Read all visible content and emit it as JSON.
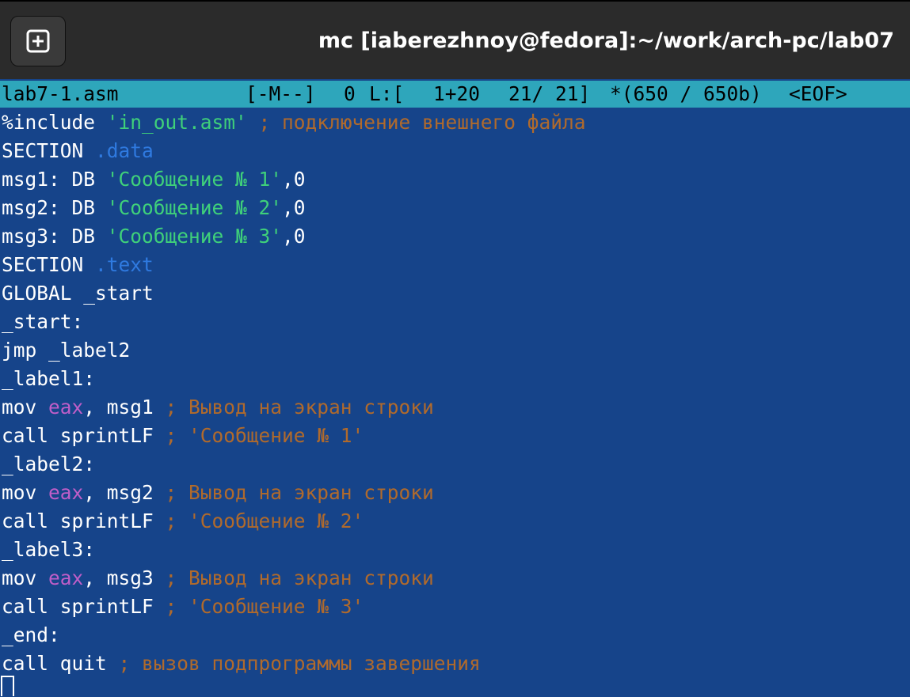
{
  "window": {
    "title": "mc [iaberezhnoy@fedora]:~/work/arch-pc/lab07",
    "new_tab_icon": "plus-in-square-icon"
  },
  "status": {
    "filename": "lab7-1.asm",
    "flags": "[-M--]",
    "col": "0",
    "line_label": "L:[",
    "line_pos": "1+20",
    "line_total": "21/ 21]",
    "bytes": "*(650 / 650b)",
    "eof": "<EOF>"
  },
  "colors": {
    "editor_bg": "#16448a",
    "status_bg": "#2ea6bb",
    "string": "#3fd07a",
    "section": "#2f7ae0",
    "comment": "#b06a2c",
    "register": "#c05ec8"
  },
  "code": [
    [
      {
        "t": "%include ",
        "c": "txt"
      },
      {
        "t": "'in_out.asm'",
        "c": "str"
      },
      {
        "t": " ; подключение внешнего файла",
        "c": "cmt"
      }
    ],
    [
      {
        "t": "SECTION ",
        "c": "txt"
      },
      {
        "t": ".data",
        "c": "sec"
      }
    ],
    [
      {
        "t": "msg1: DB ",
        "c": "txt"
      },
      {
        "t": "'Сообщение № 1'",
        "c": "str"
      },
      {
        "t": ",0",
        "c": "txt"
      }
    ],
    [
      {
        "t": "msg2: DB ",
        "c": "txt"
      },
      {
        "t": "'Сообщение № 2'",
        "c": "str"
      },
      {
        "t": ",0",
        "c": "txt"
      }
    ],
    [
      {
        "t": "msg3: DB ",
        "c": "txt"
      },
      {
        "t": "'Сообщение № 3'",
        "c": "str"
      },
      {
        "t": ",0",
        "c": "txt"
      }
    ],
    [
      {
        "t": "SECTION ",
        "c": "txt"
      },
      {
        "t": ".text",
        "c": "sec"
      }
    ],
    [
      {
        "t": "GLOBAL _start",
        "c": "txt"
      }
    ],
    [
      {
        "t": "_start:",
        "c": "txt"
      }
    ],
    [
      {
        "t": "jmp _label2",
        "c": "txt"
      }
    ],
    [
      {
        "t": "_label1:",
        "c": "txt"
      }
    ],
    [
      {
        "t": "mov ",
        "c": "txt"
      },
      {
        "t": "eax",
        "c": "reg"
      },
      {
        "t": ", msg1",
        "c": "txt"
      },
      {
        "t": " ; Вывод на экран строки",
        "c": "cmt"
      }
    ],
    [
      {
        "t": "call sprintLF",
        "c": "txt"
      },
      {
        "t": " ; 'Сообщение № 1'",
        "c": "cmt"
      }
    ],
    [
      {
        "t": "_label2:",
        "c": "txt"
      }
    ],
    [
      {
        "t": "mov ",
        "c": "txt"
      },
      {
        "t": "eax",
        "c": "reg"
      },
      {
        "t": ", msg2",
        "c": "txt"
      },
      {
        "t": " ; Вывод на экран строки",
        "c": "cmt"
      }
    ],
    [
      {
        "t": "call sprintLF",
        "c": "txt"
      },
      {
        "t": " ; 'Сообщение № 2'",
        "c": "cmt"
      }
    ],
    [
      {
        "t": "_label3:",
        "c": "txt"
      }
    ],
    [
      {
        "t": "mov ",
        "c": "txt"
      },
      {
        "t": "eax",
        "c": "reg"
      },
      {
        "t": ", msg3",
        "c": "txt"
      },
      {
        "t": " ; Вывод на экран строки",
        "c": "cmt"
      }
    ],
    [
      {
        "t": "call sprintLF",
        "c": "txt"
      },
      {
        "t": " ; 'Сообщение № 3'",
        "c": "cmt"
      }
    ],
    [
      {
        "t": "_end:",
        "c": "txt"
      }
    ],
    [
      {
        "t": "call quit",
        "c": "txt"
      },
      {
        "t": " ; вызов подпрограммы завершения",
        "c": "cmt"
      }
    ]
  ]
}
